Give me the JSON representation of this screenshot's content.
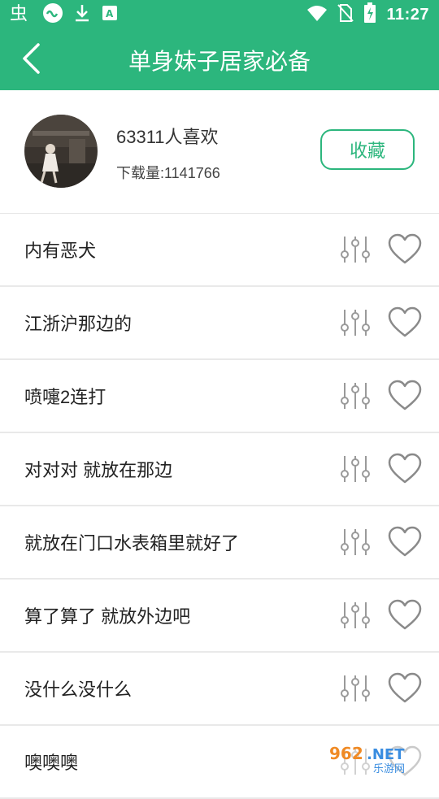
{
  "status_bar": {
    "time": "11:27",
    "left_icons": [
      "bug-app-icon",
      "cloud-link-icon",
      "download-icon",
      "app-store-icon"
    ],
    "right_icons": [
      "wifi-icon",
      "no-sim-icon",
      "battery-charging-icon"
    ]
  },
  "app_bar": {
    "title": "单身妹子居家必备",
    "back_icon": "chevron-left-icon"
  },
  "header": {
    "likes": "63311人喜欢",
    "downloads": "下载量:1141766",
    "favorite_label": "收藏"
  },
  "list": {
    "items": [
      {
        "label": "内有恶犬"
      },
      {
        "label": "江浙沪那边的"
      },
      {
        "label": "喷嚏2连打"
      },
      {
        "label": "对对对 就放在那边"
      },
      {
        "label": "就放在门口水表箱里就好了"
      },
      {
        "label": "算了算了 就放外边吧"
      },
      {
        "label": "没什么没什么"
      },
      {
        "label": "噢噢噢"
      }
    ]
  },
  "watermark": {
    "text_top": "962.NET",
    "text_bottom": "乐游网"
  },
  "colors": {
    "primary": "#2cb67d",
    "icon_gray": "#9a9a9a",
    "divider": "#e9e9e9"
  }
}
